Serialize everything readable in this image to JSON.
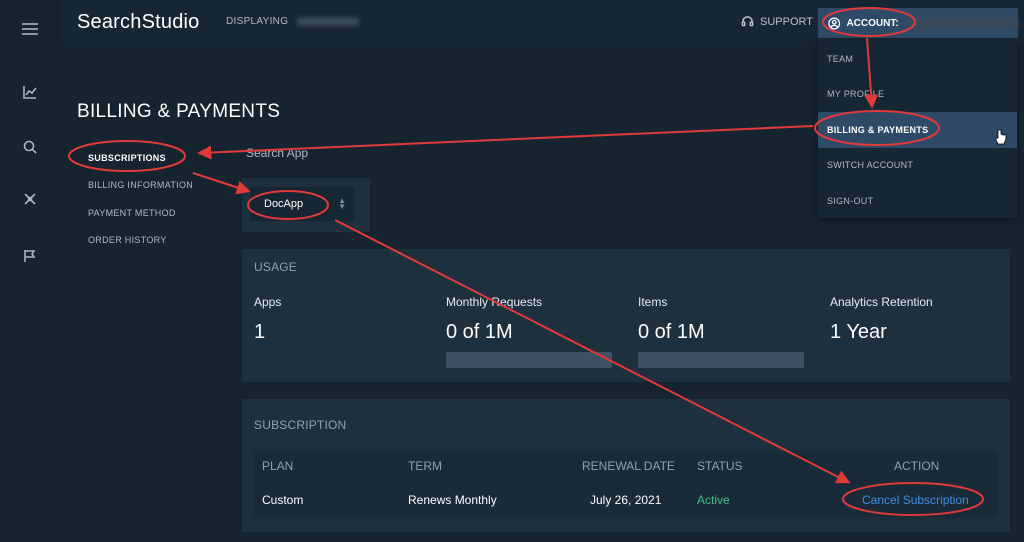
{
  "header": {
    "brand": "SearchStudio",
    "displaying_label": "DISPLAYING",
    "support_label": "SUPPORT",
    "account_label": "ACCOUNT:"
  },
  "account_menu": {
    "items": [
      {
        "label": "TEAM"
      },
      {
        "label": "MY PROFILE"
      },
      {
        "label": "BILLING & PAYMENTS",
        "active": true
      },
      {
        "label": "SWITCH ACCOUNT"
      },
      {
        "label": "SIGN-OUT"
      }
    ]
  },
  "page": {
    "title": "BILLING & PAYMENTS",
    "subnav": [
      {
        "label": "SUBSCRIPTIONS",
        "active": true
      },
      {
        "label": "BILLING INFORMATION"
      },
      {
        "label": "PAYMENT METHOD"
      },
      {
        "label": "ORDER HISTORY"
      }
    ]
  },
  "search_app": {
    "label": "Search App",
    "selected": "DocApp"
  },
  "usage": {
    "title": "USAGE",
    "columns": [
      {
        "label": "Apps",
        "value": "1",
        "progress": null
      },
      {
        "label": "Monthly Requests",
        "value": "0 of 1M",
        "progress": 0
      },
      {
        "label": "Items",
        "value": "0 of 1M",
        "progress": 0
      },
      {
        "label": "Analytics Retention",
        "value": "1 Year",
        "progress": null
      }
    ]
  },
  "subscription": {
    "title": "SUBSCRIPTION",
    "headers": {
      "plan": "PLAN",
      "term": "TERM",
      "renewal": "RENEWAL DATE",
      "status": "STATUS",
      "action": "ACTION"
    },
    "row": {
      "plan": "Custom",
      "term": "Renews Monthly",
      "renewal": "July 26, 2021",
      "status": "Active",
      "action": "Cancel Subscription"
    }
  },
  "colors": {
    "background": "#142230",
    "panel": "#1e2f3e",
    "accent": "#2f4a66",
    "active_status": "#3fbf8c",
    "link": "#3d8fe0",
    "annotation": "#e03a3a"
  },
  "icons": [
    "menu-icon",
    "chart-icon",
    "search-icon",
    "merge-icon",
    "flag-icon",
    "headset-icon",
    "user-circle-icon",
    "hand-cursor-icon",
    "sort-chevron-icon"
  ]
}
